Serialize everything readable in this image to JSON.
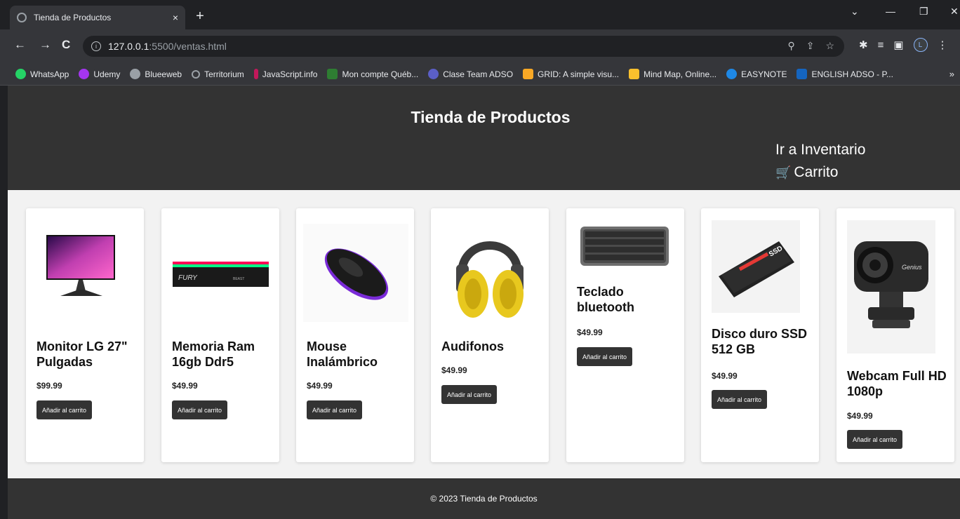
{
  "browser": {
    "tab_title": "Tienda de Productos",
    "tab_close": "×",
    "new_tab": "+",
    "url_host": "127.0.0.1",
    "url_path": ":5500/ventas.html",
    "profile_initial": "L",
    "bookmarks": [
      {
        "label": "WhatsApp",
        "color": "#25d366"
      },
      {
        "label": "Udemy",
        "color": "#a435f0"
      },
      {
        "label": "Blueeweb",
        "color": "#9aa0a6"
      },
      {
        "label": "Territorium",
        "color": "#5f6368"
      },
      {
        "label": "JavaScript.info",
        "color": "#c2185b"
      },
      {
        "label": "Mon compte Québ...",
        "color": "#2e7d32"
      },
      {
        "label": "Clase Team ADSO",
        "color": "#5b5fc7"
      },
      {
        "label": "GRID: A simple visu...",
        "color": "#f9a825"
      },
      {
        "label": "Mind Map, Online...",
        "color": "#fbc02d"
      },
      {
        "label": "EASYNOTE",
        "color": "#1e88e5"
      },
      {
        "label": "ENGLISH ADSO - P...",
        "color": "#1565c0"
      }
    ],
    "bookmarks_more": "»"
  },
  "header": {
    "title": "Tienda de Productos",
    "inventory_link": "Ir a Inventario",
    "cart_link": "Carrito"
  },
  "products": [
    {
      "name": "Monitor LG 27\" Pulgadas",
      "price": "$99.99",
      "button": "Añadir al carrito",
      "icon": "monitor-image"
    },
    {
      "name": "Memoria Ram 16gb Ddr5",
      "price": "$49.99",
      "button": "Añadir al carrito",
      "icon": "ram-image"
    },
    {
      "name": "Mouse Inalámbrico",
      "price": "$49.99",
      "button": "Añadir al carrito",
      "icon": "mouse-image"
    },
    {
      "name": "Audifonos",
      "price": "$49.99",
      "button": "Añadir al carrito",
      "icon": "headphones-image"
    },
    {
      "name": "Teclado bluetooth",
      "price": "$49.99",
      "button": "Añadir al carrito",
      "icon": "keyboard-image"
    },
    {
      "name": "Disco duro SSD 512 GB",
      "price": "$49.99",
      "button": "Añadir al carrito",
      "icon": "ssd-image"
    },
    {
      "name": "Webcam Full HD 1080p",
      "price": "$49.99",
      "button": "Añadir al carrito",
      "icon": "webcam-image"
    }
  ],
  "footer": {
    "text": "© 2023 Tienda de Productos"
  },
  "colors": {
    "header_bg": "#333333",
    "page_bg": "#f2f2f2",
    "button_bg": "#333333"
  }
}
